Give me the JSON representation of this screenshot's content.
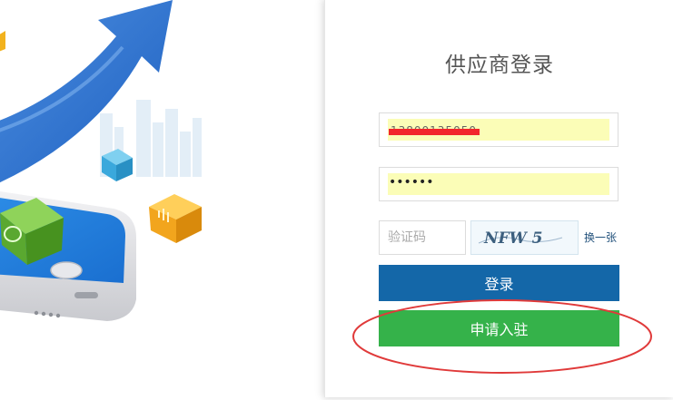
{
  "panel": {
    "title": "供应商登录"
  },
  "form": {
    "username_value": "13800135050",
    "password_value": "••••••",
    "captcha_placeholder": "验证码",
    "captcha_text": "NFW 5",
    "refresh_label": "换一张"
  },
  "buttons": {
    "login_label": "登录",
    "apply_label": "申请入驻"
  },
  "colors": {
    "login_button": "#1467a8",
    "apply_button": "#35b24a",
    "autofill_background": "#fbfdb7",
    "redaction_bar": "#f2262b",
    "annotation_ellipse": "#e03a3a"
  },
  "icons": {
    "illustration": "phone-with-growth-arrow-illustration",
    "cube_green": "chat-bubble-cube-icon",
    "cube_orange": "bar-chart-cube-icon",
    "cube_blue": "chart-cube-icon"
  }
}
